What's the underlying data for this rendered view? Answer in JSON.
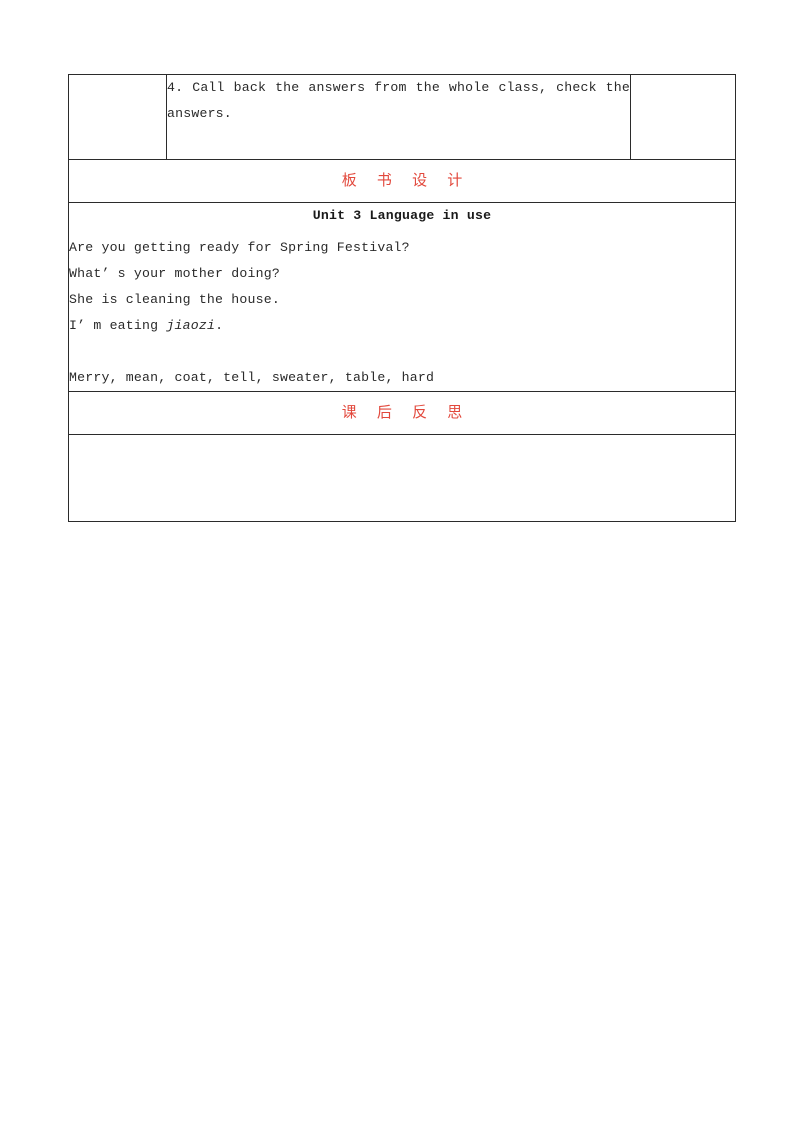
{
  "document": {
    "type": "lesson-plan-table",
    "background_color": "#ffffff",
    "border_color": "#2b2b2b",
    "accent_color": "#e2483c"
  },
  "table": {
    "procedure_row": {
      "left_cell": "",
      "step_text": "4. Call back the answers from the whole class, check the answers.",
      "right_cell": ""
    },
    "board_design_section": {
      "header": "板 书 设 计",
      "heading": "Unit 3 Language in use",
      "lines": [
        {
          "text": "Are you getting ready for Spring Festival?",
          "italic_part": ""
        },
        {
          "text": "What’ s your mother doing?",
          "italic_part": ""
        },
        {
          "text": "She is cleaning the house.",
          "italic_part": ""
        },
        {
          "text": "I’ m eating ",
          "italic_part": "jiaozi",
          "tail": "."
        }
      ],
      "word_list": "Merry, mean, coat, tell, sweater, table, hard"
    },
    "reflection_section": {
      "header": "课 后 反 思",
      "body": ""
    }
  }
}
